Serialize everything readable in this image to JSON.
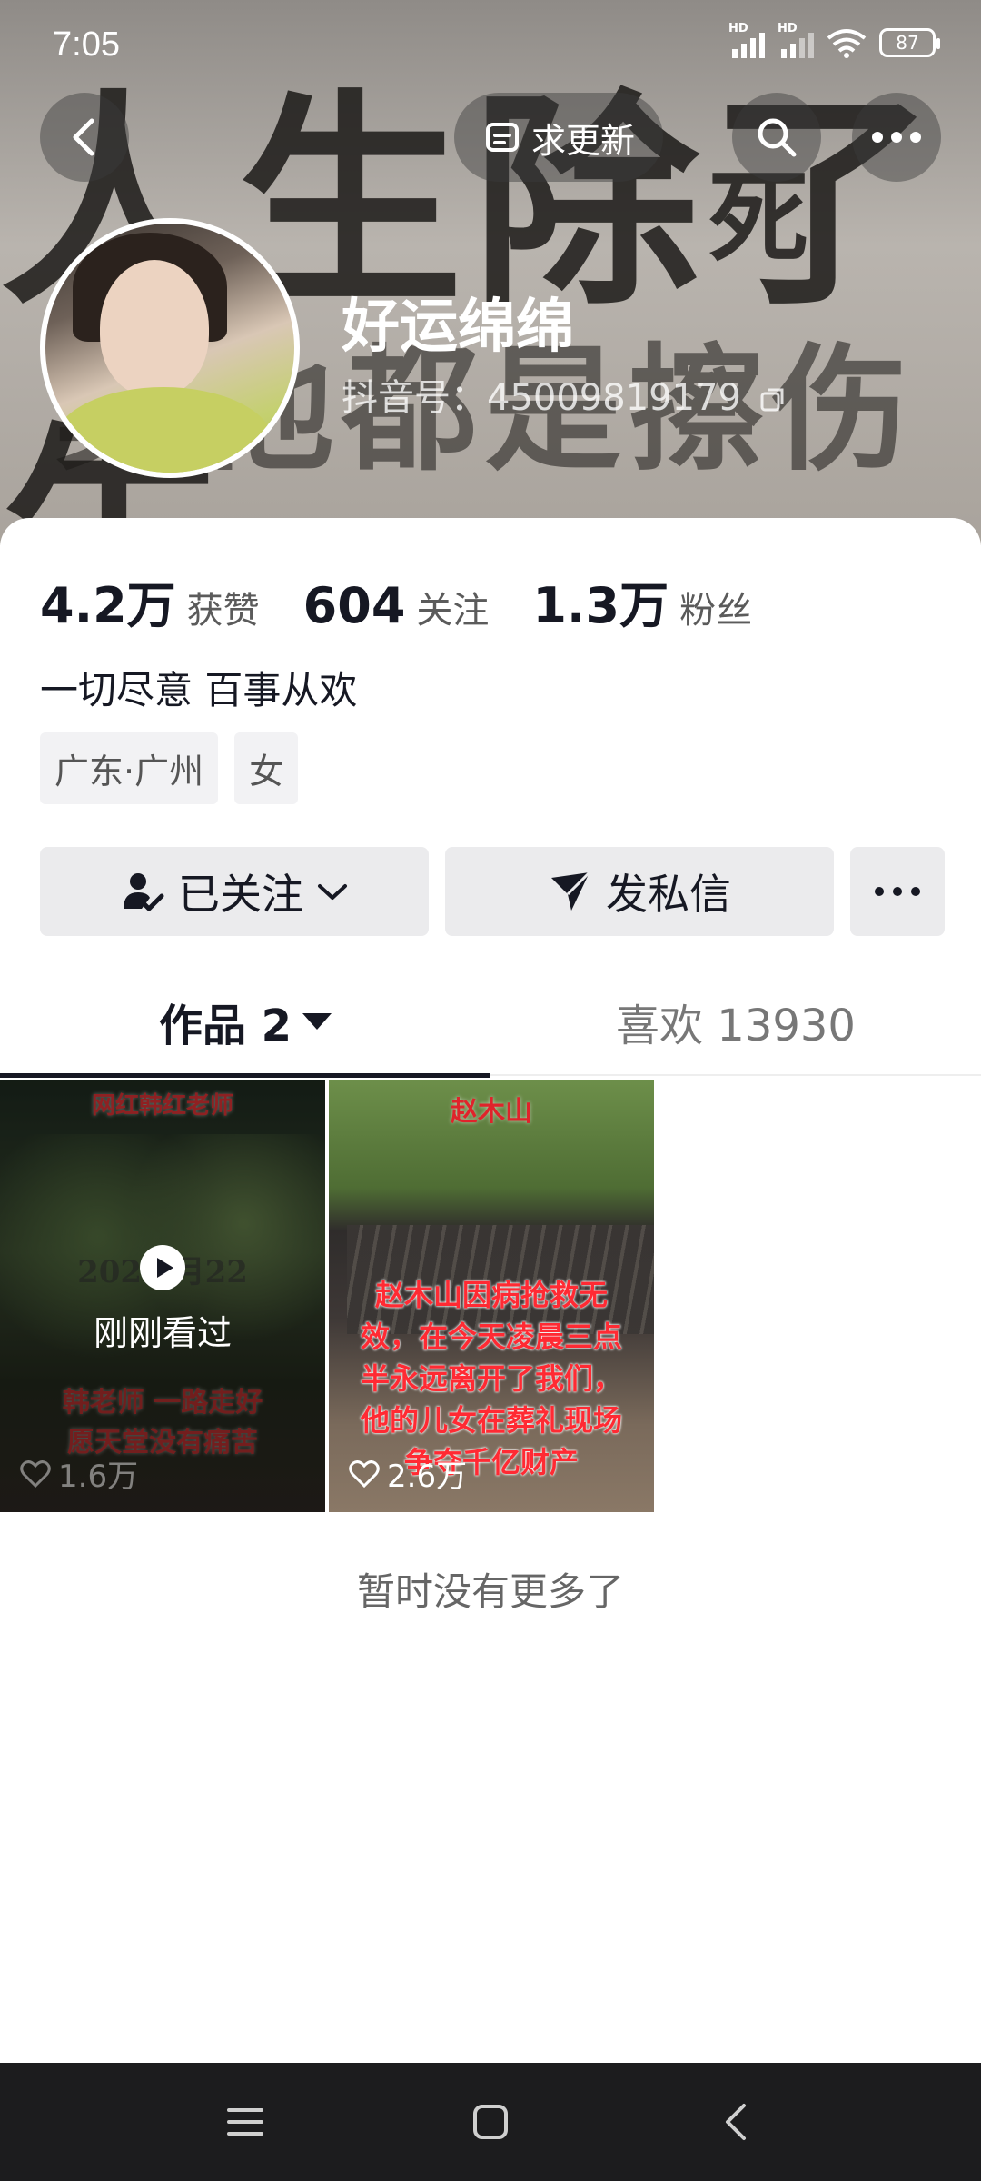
{
  "status_bar": {
    "time": "7:05",
    "battery": "87",
    "hd1": "HD",
    "hd2": "HD"
  },
  "header": {
    "update_label": "求更新",
    "banner_text_1": "人生除了生",
    "banner_text_2": "死",
    "banner_text_3": "其他都是擦伤",
    "nickname": "好运绵绵",
    "douyin_id": "抖音号：45009819179"
  },
  "stats": [
    {
      "num": "4.2万",
      "label": "获赞"
    },
    {
      "num": "604",
      "label": "关注"
    },
    {
      "num": "1.3万",
      "label": "粉丝"
    }
  ],
  "bio": "一切尽意 百事从欢",
  "tags": [
    "广东·广州",
    "女"
  ],
  "actions": {
    "follow": "已关注",
    "message": "发私信"
  },
  "tabs": {
    "works": "作品 2",
    "likes": "喜欢 13930"
  },
  "videos": [
    {
      "title_top": "网红韩红老师",
      "date_text": "2025 月22",
      "line1": "韩老师 一路走好",
      "line2": "愿天堂没有痛苦",
      "watched": "刚刚看过",
      "likes": "1.6万"
    },
    {
      "title_top": "赵木山",
      "body": "赵木山因病抢救无效，在今天凌晨三点半永远离开了我们，他的儿女在葬礼现场争夺千亿财产",
      "likes": "2.6万"
    }
  ],
  "footer_text": "暂时没有更多了"
}
